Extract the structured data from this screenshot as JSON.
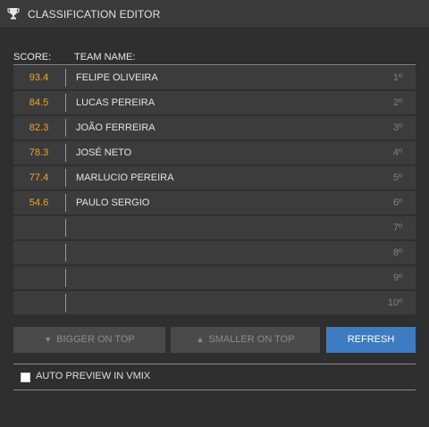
{
  "window": {
    "title": "CLASSIFICATION EDITOR",
    "icon": "trophy-icon"
  },
  "table": {
    "headers": {
      "score": "SCORE:",
      "team": "TEAM NAME:"
    },
    "rows": [
      {
        "score": "93.4",
        "team": "FELIPE OLIVEIRA",
        "rank": "1º"
      },
      {
        "score": "84.5",
        "team": "LUCAS PEREIRA",
        "rank": "2º"
      },
      {
        "score": "82.3",
        "team": "JOÃO FERREIRA",
        "rank": "3º"
      },
      {
        "score": "78.3",
        "team": "JOSÉ NETO",
        "rank": "4º"
      },
      {
        "score": "77.4",
        "team": "MARLUCIO PEREIRA",
        "rank": "5º"
      },
      {
        "score": "54.6",
        "team": "PAULO SERGIO",
        "rank": "6º"
      },
      {
        "score": "",
        "team": "",
        "rank": "7º"
      },
      {
        "score": "",
        "team": "",
        "rank": "8º"
      },
      {
        "score": "",
        "team": "",
        "rank": "9º"
      },
      {
        "score": "",
        "team": "",
        "rank": "10º"
      }
    ]
  },
  "buttons": {
    "bigger_on_top": "BIGGER ON TOP",
    "smaller_on_top": "SMALLER ON TOP",
    "refresh": "REFRESH"
  },
  "options": {
    "auto_preview_label": "AUTO PREVIEW IN VMIX",
    "auto_preview_checked": false
  },
  "colors": {
    "score": "#f0a624",
    "accent": "#3d7cc2",
    "background": "#2f2f2f"
  }
}
